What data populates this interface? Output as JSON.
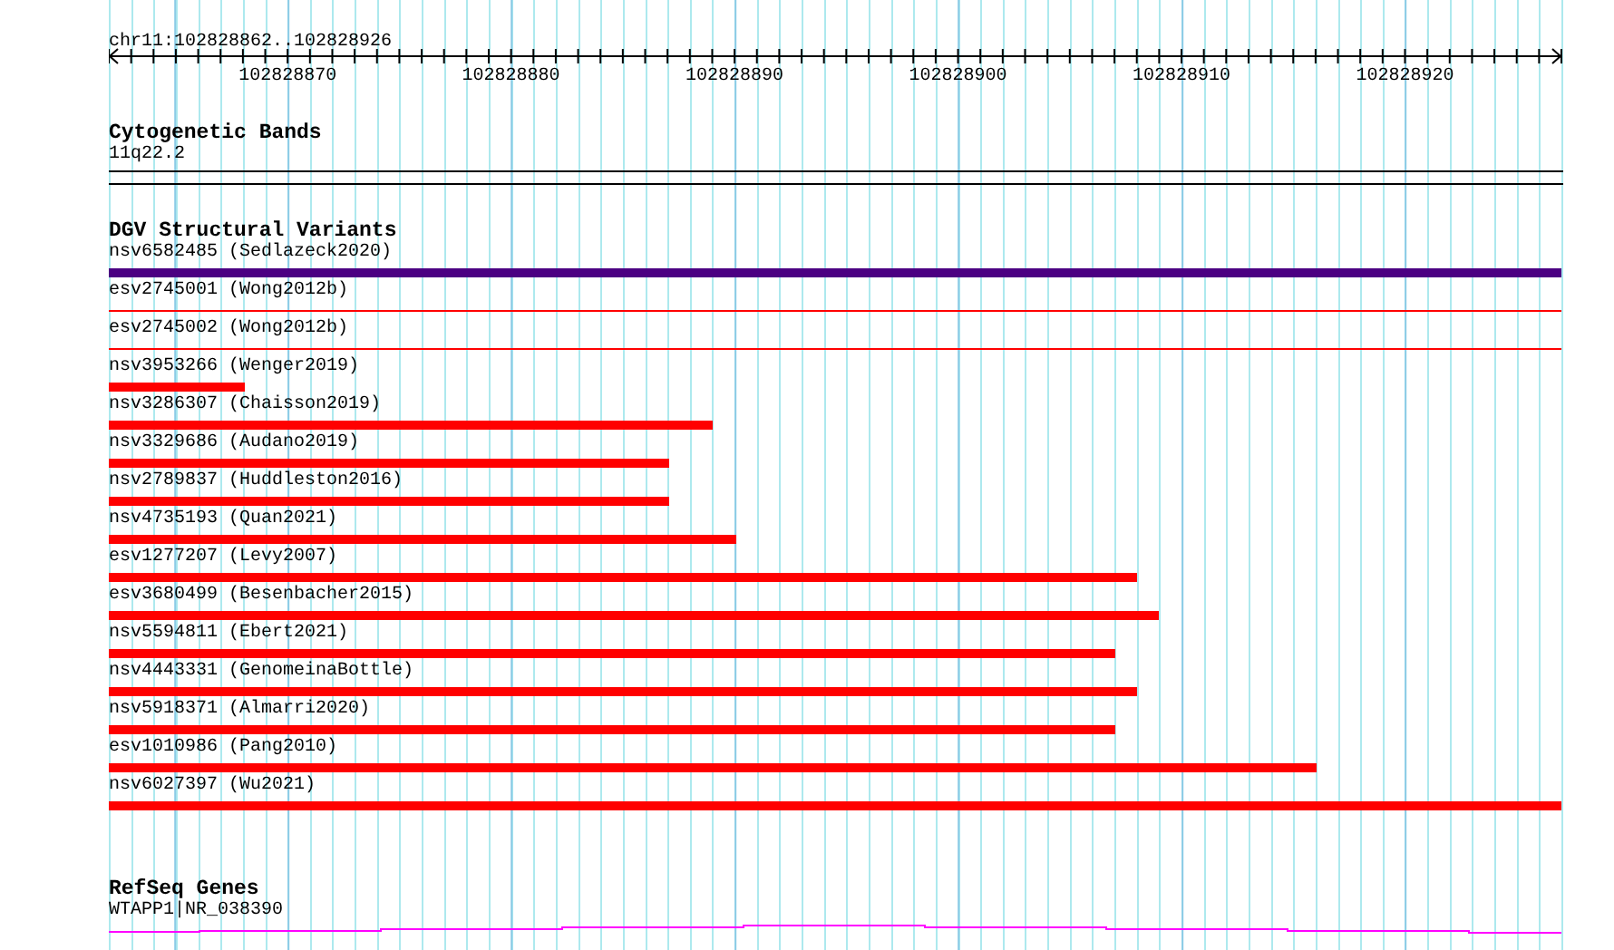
{
  "ruler": {
    "range": "chr11:102828862..102828926",
    "tick_labels": [
      "102828870",
      "102828880",
      "102828890",
      "102828900",
      "102828910",
      "102828920"
    ]
  },
  "cytogenetic_bands": {
    "title": "Cytogenetic Bands",
    "band": "11q22.2"
  },
  "dgv_structural_variants": {
    "title": "DGV Structural Variants",
    "variants": [
      {
        "label": "nsv6582485 (Sedlazeck2020)",
        "kind": "bar",
        "color": "#4b0082",
        "level": 1
      },
      {
        "label": "esv2745001 (Wong2012b)",
        "kind": "line",
        "color": "#ff0000",
        "level": 1
      },
      {
        "label": "esv2745002 (Wong2012b)",
        "kind": "line",
        "color": "#ff0000",
        "level": 1
      },
      {
        "label": "nsv3953266 (Wenger2019)",
        "kind": "bar",
        "color": "#ff0000",
        "level": 0.094
      },
      {
        "label": "nsv3286307 (Chaisson2019)",
        "kind": "bar",
        "color": "#ff0000",
        "level": 0.416
      },
      {
        "label": "nsv3329686 (Audano2019)",
        "kind": "bar",
        "color": "#ff0000",
        "level": 0.386
      },
      {
        "label": "nsv2789837 (Huddleston2016)",
        "kind": "bar",
        "color": "#ff0000",
        "level": 0.386
      },
      {
        "label": "nsv4735193 (Quan2021)",
        "kind": "bar",
        "color": "#ff0000",
        "level": 0.432
      },
      {
        "label": "esv1277207 (Levy2007)",
        "kind": "bar",
        "color": "#ff0000",
        "level": 0.708
      },
      {
        "label": "esv3680499 (Besenbacher2015)",
        "kind": "bar",
        "color": "#ff0000",
        "level": 0.723
      },
      {
        "label": "nsv5594811 (Ebert2021)",
        "kind": "bar",
        "color": "#ff0000",
        "level": 0.693
      },
      {
        "label": "nsv4443331 (GenomeinaBottle)",
        "kind": "bar",
        "color": "#ff0000",
        "level": 0.708
      },
      {
        "label": "nsv5918371 (Almarri2020)",
        "kind": "bar",
        "color": "#ff0000",
        "level": 0.693
      },
      {
        "label": "esv1010986 (Pang2010)",
        "kind": "bar",
        "color": "#ff0000",
        "level": 0.831
      },
      {
        "label": "nsv6027397 (Wu2021)",
        "kind": "bar",
        "color": "#ff0000",
        "level": 1
      }
    ]
  },
  "refseq_genes": {
    "title": "RefSeq Genes",
    "gene": "WTAPP1|NR_038390"
  }
}
